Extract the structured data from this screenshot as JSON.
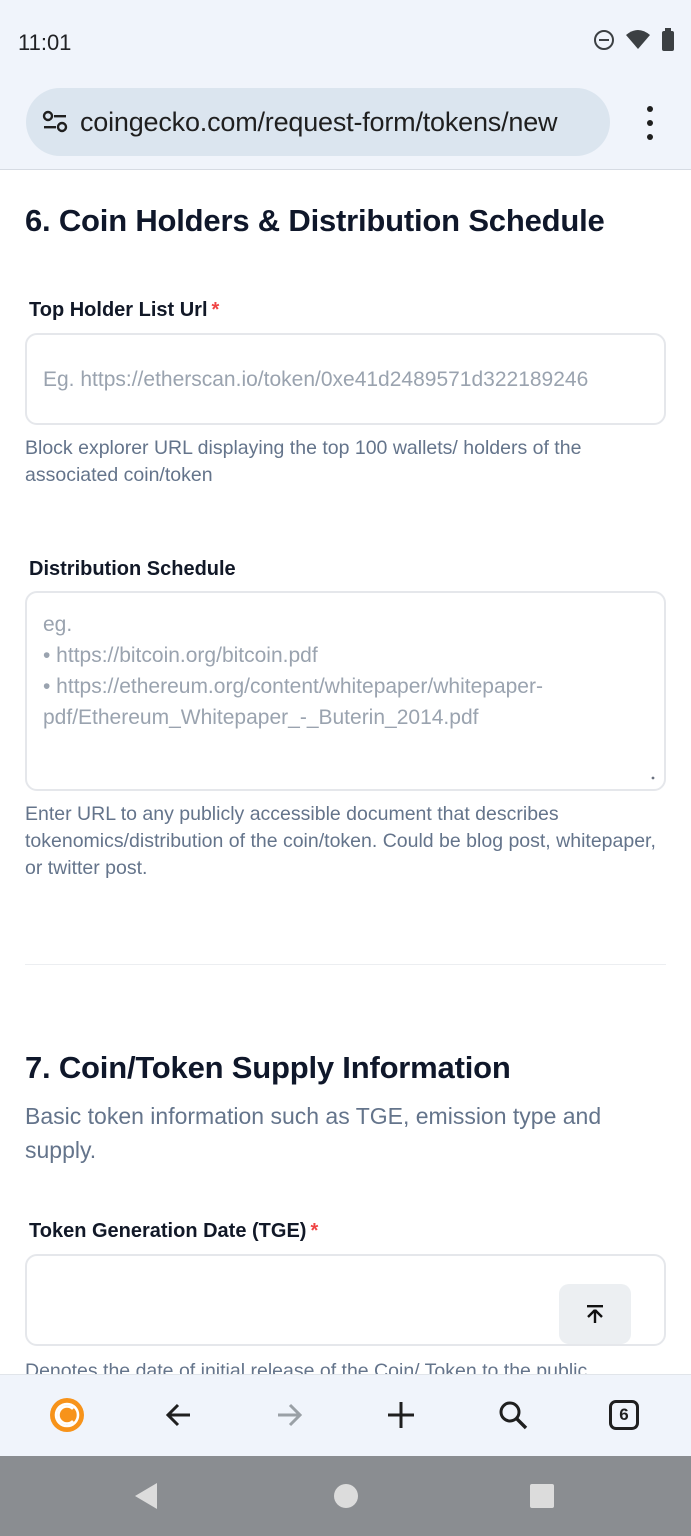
{
  "status_bar": {
    "time": "11:01"
  },
  "browser": {
    "url": "coingecko.com/request-form/tokens/new"
  },
  "section6": {
    "title": "6. Coin Holders & Distribution Schedule",
    "top_holder": {
      "label": "Top Holder List Url",
      "required_mark": "*",
      "placeholder": "Eg. https://etherscan.io/token/0xe41d2489571d322189246",
      "help": "Block explorer URL displaying the top 100 wallets/ holders of the associated coin/token"
    },
    "distribution": {
      "label": "Distribution Schedule",
      "placeholder_lines": [
        "eg.",
        "• https://bitcoin.org/bitcoin.pdf",
        "• https://ethereum.org/content/whitepaper/whitepaper-",
        "pdf/Ethereum_Whitepaper_-_Buterin_2014.pdf"
      ],
      "help": "Enter URL to any publicly accessible document that describes tokenomics/distribution of the coin/token. Could be blog post, whitepaper, or twitter post."
    }
  },
  "section7": {
    "title": "7. Coin/Token Supply Information",
    "subtitle": "Basic token information such as TGE, emission type and supply.",
    "tge": {
      "label": "Token Generation Date (TGE)",
      "required_mark": "*",
      "value": "",
      "help": "Denotes the date of initial release of the Coin/ Token to the public"
    }
  },
  "toolbar": {
    "tab_count": "6"
  },
  "colors": {
    "accent": "#f7931a",
    "required": "#ef4444",
    "muted_text": "#64748b"
  },
  "icons": [
    "dnd-icon",
    "wifi-icon",
    "battery-icon",
    "site-settings-icon",
    "more-vert-icon",
    "coingecko-icon",
    "back-arrow-icon",
    "forward-arrow-icon",
    "new-tab-icon",
    "search-icon",
    "tabs-icon",
    "scroll-to-top-icon"
  ]
}
